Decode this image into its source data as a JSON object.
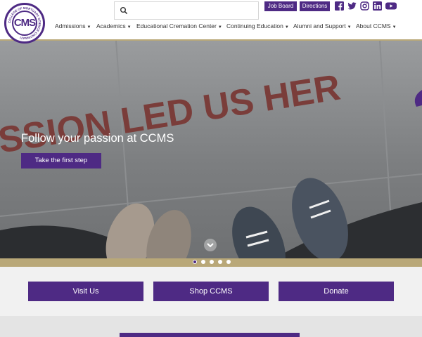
{
  "logo": {
    "monogram": "CMS",
    "ring_text": "COLLEGE OF MORTUARY SCIENCE CINCINNATI"
  },
  "search": {
    "placeholder": "",
    "icon": "search-icon"
  },
  "top_links": [
    {
      "label": "Job Board"
    },
    {
      "label": "Directions"
    }
  ],
  "social": [
    "facebook-icon",
    "twitter-icon",
    "instagram-icon",
    "linkedin-icon",
    "youtube-icon"
  ],
  "nav": [
    {
      "label": "Admissions"
    },
    {
      "label": "Academics"
    },
    {
      "label": "Educational Cremation Center"
    },
    {
      "label": "Continuing Education"
    },
    {
      "label": "Alumni and Support"
    },
    {
      "label": "About CCMS"
    }
  ],
  "hero": {
    "painted_text": "SSION LED US HER",
    "title": "Follow your passion at CCMS",
    "button": "Take the first step",
    "slides": 5,
    "active_slide": 1
  },
  "actions": [
    {
      "label": "Visit Us"
    },
    {
      "label": "Shop CCMS"
    },
    {
      "label": "Donate"
    }
  ],
  "colors": {
    "brand": "#4e2a84",
    "gold": "#b9a878",
    "social_icon": "#4e2a84"
  }
}
